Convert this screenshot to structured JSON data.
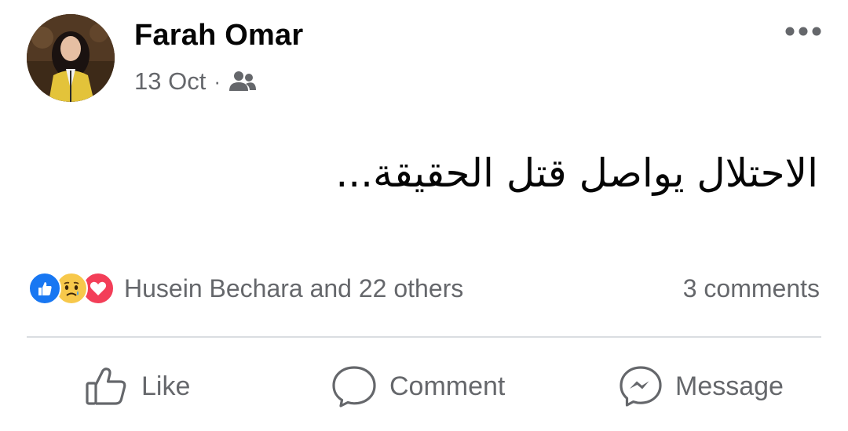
{
  "post": {
    "author": {
      "name": "Farah Omar",
      "avatar_icon": "profile-photo"
    },
    "meta": {
      "date": "13 Oct",
      "separator": "·",
      "audience_icon": "friends-icon"
    },
    "more_icon": "more-dots-icon",
    "text": "الاحتلال يواصل قتل الحقيقة...",
    "reactions": {
      "icons": [
        "like-icon",
        "sad-icon",
        "love-icon"
      ],
      "summary": "Husein Bechara and 22 others"
    },
    "comments_count": "3 comments",
    "actions": {
      "like": "Like",
      "comment": "Comment",
      "message": "Message"
    }
  },
  "colors": {
    "text_primary": "#050505",
    "text_secondary": "#65676b",
    "like_blue": "#1877f2",
    "love_red": "#f33e58",
    "sad_yellow": "#f7c84b",
    "divider": "#dadde1"
  }
}
